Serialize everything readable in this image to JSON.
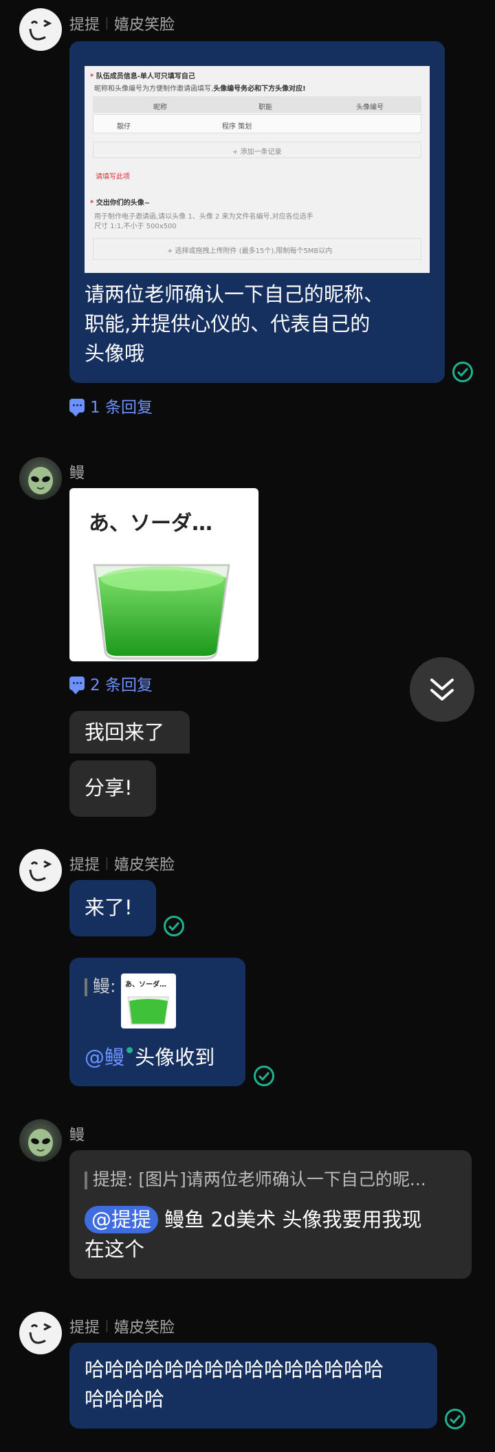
{
  "messages": {
    "m1": {
      "sender": "提提",
      "nickname": "嬉皮笑脸",
      "form": {
        "section1_title": "队伍成员信息-单人可只填写自己",
        "section1_desc_a": "昵称和头像编号为方便制作邀请函填写,",
        "section1_desc_b": "头像编号务必和下方头像对应!",
        "col_nickname": "昵称",
        "col_role": "职能",
        "col_avatar": "头像编号",
        "row_name": "靓仔",
        "row_role": "程序 策划",
        "add_record": "+ 添加一条记录",
        "required": "请填写此项",
        "section2_title": "交出你们的头像~",
        "section2_desc1": "用于制作电子邀请函,请以头像 1、头像 2 来为文件名编号,对应各位选手",
        "section2_desc2": "尺寸 1:1,不小于 500x500",
        "upload": "+ 选择或拖拽上传附件 (最多15个),限制每个5MB以内"
      },
      "text_line1": "请两位老师确认一下自己的昵称、",
      "text_line2": "职能,并提供心仪的、代表自己的",
      "text_line3": "头像哦",
      "replies": "1 条回复"
    },
    "m2": {
      "sender": "鳗",
      "sticker_text": "あ、ソーダ…",
      "replies": "2 条回复",
      "text_a": "我回来了",
      "text_b": "分享!"
    },
    "m3": {
      "sender": "提提",
      "nickname": "嬉皮笑脸",
      "text": "来了!",
      "quote_prefix": "鳗:",
      "quote_sticker_text": "あ、ソーダ…",
      "mention": "@鳗",
      "text2": " 头像收到"
    },
    "m4": {
      "sender": "鳗",
      "quote": "提提: [图片]请两位老师确认一下自己的昵...",
      "mention": "@提提",
      "text_line1": " 鳗鱼 2d美术 头像我要用我现",
      "text_line2": "在这个"
    },
    "m5": {
      "sender": "提提",
      "nickname": "嬉皮笑脸",
      "text_line1": "哈哈哈哈哈哈哈哈哈哈哈哈哈哈哈",
      "text_line2": "哈哈哈哈"
    }
  },
  "icons": {
    "avatar_smiley": "smiley-avatar-icon",
    "avatar_alien": "alien-avatar-icon",
    "read_check": "check-circle-icon",
    "reply": "comment-icon",
    "scroll_down": "double-chevron-down-icon"
  },
  "colors": {
    "background": "#0b0b0b",
    "own_bubble": "#15305f",
    "other_bubble": "#2b2b2b",
    "accent_blue": "#6d92ff",
    "mention_bg": "#3f6de0",
    "read_green": "#1fb38f"
  }
}
